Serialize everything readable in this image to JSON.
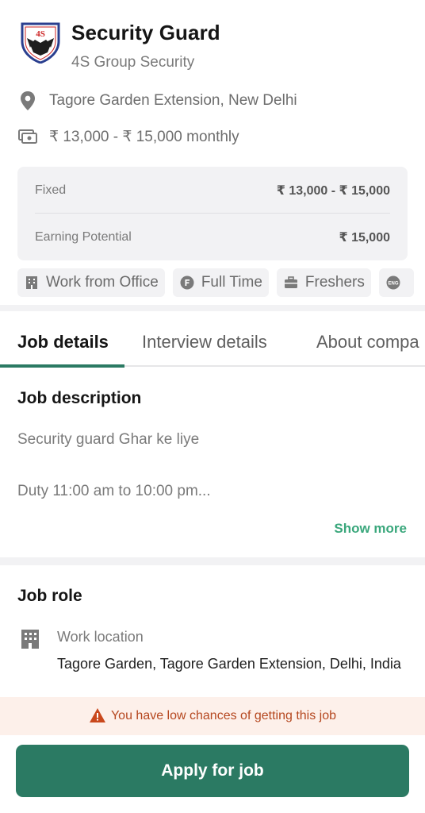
{
  "job": {
    "title": "Security Guard",
    "company": "4S Group Security",
    "logo_text": "4S",
    "location": "Tagore Garden Extension, New Delhi",
    "salary": "₹ 13,000 - ₹ 15,000 monthly"
  },
  "salary_breakdown": {
    "fixed_label": "Fixed",
    "fixed_value": "₹ 13,000 - ₹ 15,000",
    "potential_label": "Earning Potential",
    "potential_value": "₹ 15,000"
  },
  "tags": [
    {
      "label": "Work from Office",
      "icon": "building-icon"
    },
    {
      "label": "Full Time",
      "icon": "full-time-icon"
    },
    {
      "label": "Freshers",
      "icon": "briefcase-icon"
    },
    {
      "label": "",
      "icon": "english-icon"
    }
  ],
  "tabs": [
    {
      "label": "Job details",
      "active": true
    },
    {
      "label": "Interview details",
      "active": false
    },
    {
      "label": "About compa",
      "active": false
    }
  ],
  "description": {
    "title": "Job description",
    "line1": "Security guard Ghar ke liye",
    "line2": "Duty 11:00 am to 10:00 pm...",
    "show_more": "Show more"
  },
  "role": {
    "title": "Job role",
    "location_label": "Work location",
    "location_value": "Tagore Garden, Tagore Garden Extension, Delhi, India"
  },
  "warning": {
    "text": "You have low chances of getting this job",
    "color": "#b5471f"
  },
  "apply": {
    "label": "Apply for job",
    "color": "#2b7a63"
  },
  "colors": {
    "accent": "#2b7a63",
    "show_more": "#3aa77c",
    "warning_bg": "#fdf0ea"
  }
}
